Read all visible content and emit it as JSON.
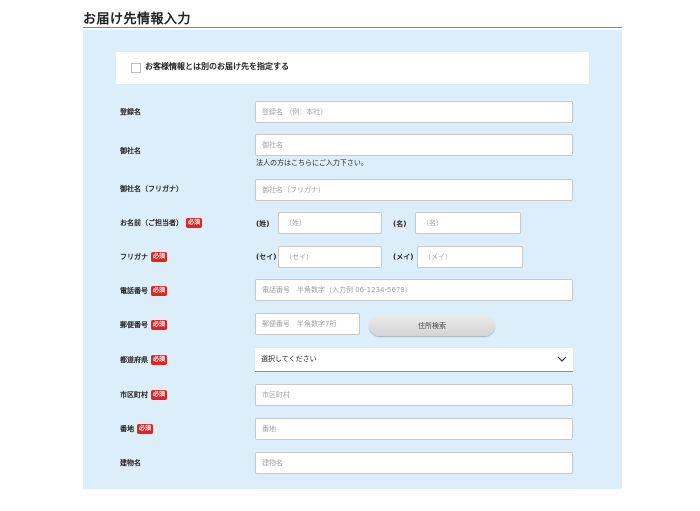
{
  "section": {
    "title": "お届け先情報入力"
  },
  "toggle": {
    "label": "お客様情報とは別のお届け先を指定する"
  },
  "badge": "必須",
  "fields": {
    "registration": {
      "label": "登録名",
      "placeholder": "登録名 （例：本社）"
    },
    "company": {
      "label": "御社名",
      "placeholder": "御社名",
      "note": "法人の方はこちらにご入力下さい。"
    },
    "company_kana": {
      "label": "御社名（フリガナ）",
      "placeholder": "御社名（フリガナ）"
    },
    "name": {
      "label": "お名前（ご担当者）",
      "last_label": "(姓)",
      "last_placeholder": "（姓）",
      "first_label": "(名)",
      "first_placeholder": "（名）"
    },
    "kana": {
      "label": "フリガナ",
      "last_label": "(セイ)",
      "last_placeholder": "（セイ）",
      "first_label": "(メイ)",
      "first_placeholder": "（メイ）"
    },
    "phone": {
      "label": "電話番号",
      "placeholder": "電話番号　半角数字（入力例 06-1234-5678）"
    },
    "postal": {
      "label": "郵便番号",
      "placeholder": "郵便番号　半角数字7桁",
      "button": "住所検索"
    },
    "prefecture": {
      "label": "都道府県",
      "selected": "選択してください"
    },
    "city": {
      "label": "市区町村",
      "placeholder": "市区町村"
    },
    "street": {
      "label": "番地",
      "placeholder": "番地"
    },
    "building": {
      "label": "建物名",
      "placeholder": "建物名"
    }
  }
}
